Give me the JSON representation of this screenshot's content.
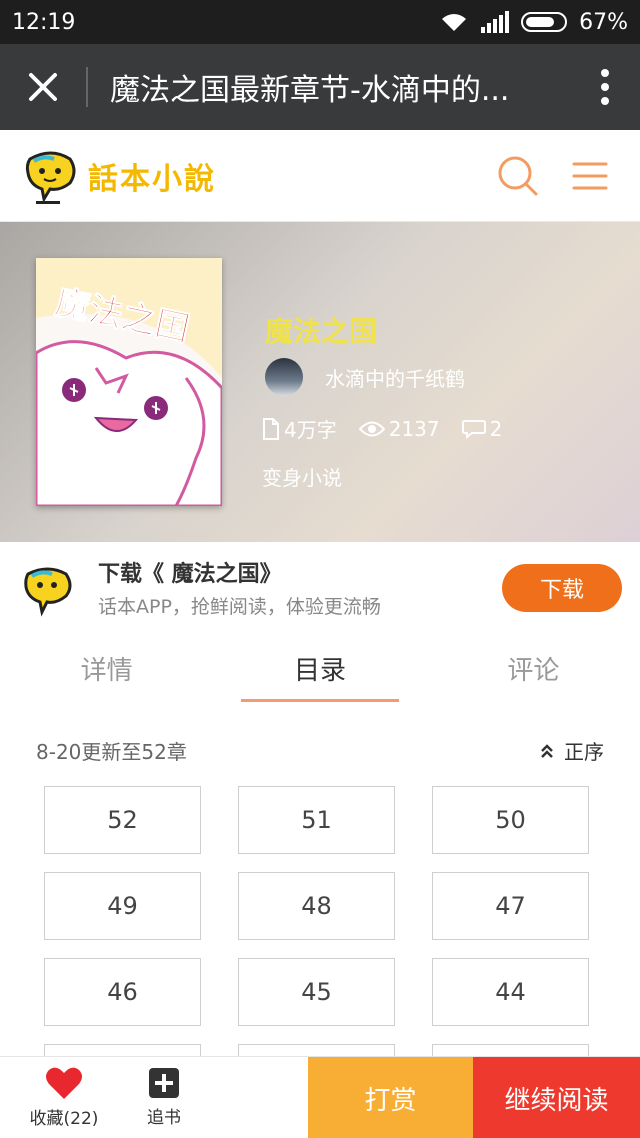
{
  "status_bar": {
    "time": "12:19",
    "battery": "67%"
  },
  "title_bar": {
    "title": "魔法之国最新章节-水滴中的..."
  },
  "site": {
    "logo_text": "話本小說"
  },
  "book": {
    "title": "魔法之国",
    "cover_title": "魔法之国",
    "author": "水滴中的千纸鹤",
    "word_count": "4万字",
    "views": "2137",
    "comments": "2",
    "category": "变身小说"
  },
  "banner": {
    "title": "下载《 魔法之国》",
    "subtitle": "话本APP，抢鲜阅读，体验更流畅",
    "button": "下载"
  },
  "tabs": [
    {
      "label": "详情"
    },
    {
      "label": "目录"
    },
    {
      "label": "评论"
    }
  ],
  "catalog": {
    "update_text": "8-20更新至52章",
    "order_label": "正序",
    "chapters": [
      "52",
      "51",
      "50",
      "49",
      "48",
      "47",
      "46",
      "45",
      "44"
    ]
  },
  "bottom_bar": {
    "favorite_label": "收藏(22)",
    "follow_label": "追书",
    "reward_label": "打赏",
    "continue_label": "继续阅读"
  },
  "colors": {
    "accent_orange": "#f06f1a",
    "reward_orange": "#f8ad35",
    "continue_red": "#ee3a2e",
    "tab_underline": "#f39b73",
    "book_title_yellow": "#f0e24a"
  }
}
